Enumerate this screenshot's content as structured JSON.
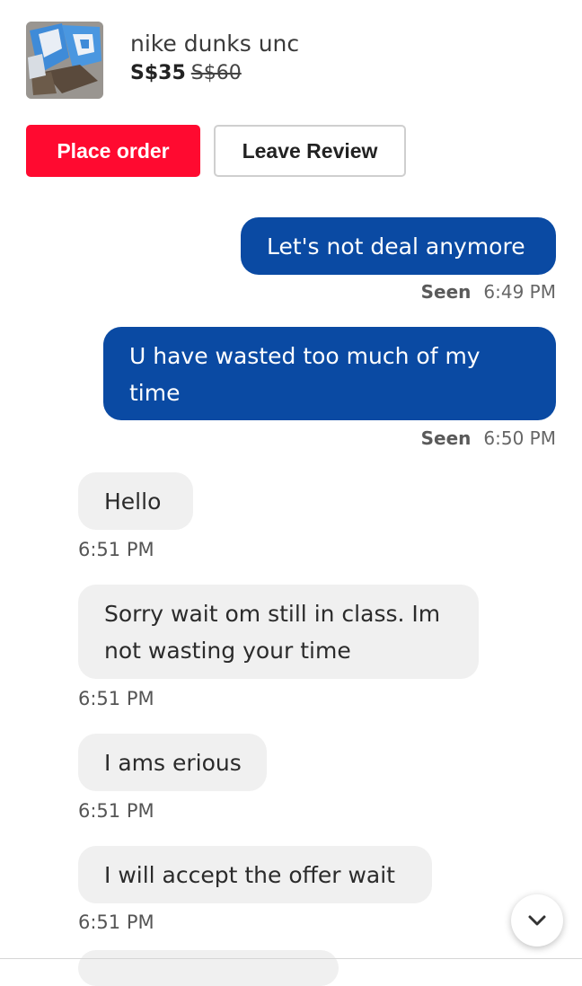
{
  "listing": {
    "title": "nike dunks unc",
    "price": "S$35",
    "original_price": "S$60",
    "thumbnail_icon": "sneaker-photo"
  },
  "actions": {
    "place_order_label": "Place order",
    "leave_review_label": "Leave Review"
  },
  "messages": [
    {
      "direction": "outgoing",
      "text": "Let's not deal anymore",
      "status": "Seen",
      "time": "6:49 PM"
    },
    {
      "direction": "outgoing",
      "text": "U have wasted too much of my time",
      "status": "Seen",
      "time": "6:50 PM"
    },
    {
      "direction": "incoming",
      "text": "Hello",
      "time": "6:51 PM"
    },
    {
      "direction": "incoming",
      "text": "Sorry wait om still in class. Im not wasting your time",
      "time": "6:51 PM"
    },
    {
      "direction": "incoming",
      "text": "I ams erious",
      "time": "6:51 PM"
    },
    {
      "direction": "incoming",
      "text": "I will accept the offer wait",
      "time": "6:51 PM"
    }
  ],
  "scroll_button_icon": "chevron-down-icon",
  "colors": {
    "place_order": "#ff0a30",
    "outgoing_bubble": "#0a4aa3",
    "incoming_bubble": "#f0f0f0"
  }
}
